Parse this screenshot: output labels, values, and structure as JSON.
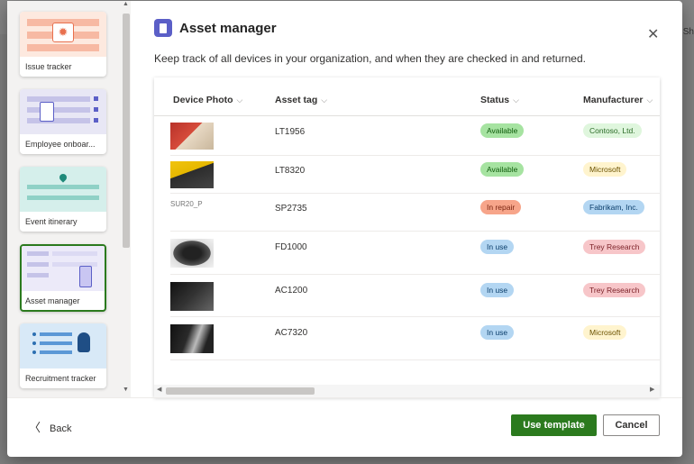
{
  "backdrop": {
    "right_text": "Sh"
  },
  "dialog": {
    "title": "Asset manager",
    "subtitle": "Keep track of all devices in your organization, and when they are checked in and returned."
  },
  "templates": [
    {
      "label": "Issue tracker"
    },
    {
      "label": "Employee onboar..."
    },
    {
      "label": "Event itinerary"
    },
    {
      "label": "Asset manager",
      "selected": true
    },
    {
      "label": "Recruitment tracker"
    }
  ],
  "table": {
    "columns": [
      "Device Photo",
      "Asset tag",
      "Status",
      "Manufacturer"
    ],
    "rows": [
      {
        "asset_tag": "LT1956",
        "status": "Available",
        "manufacturer": "Contoso, Ltd."
      },
      {
        "asset_tag": "LT8320",
        "status": "Available",
        "manufacturer": "Microsoft"
      },
      {
        "photo_alt": "SUR20_P",
        "asset_tag": "SP2735",
        "status": "In repair",
        "manufacturer": "Fabrikam, Inc."
      },
      {
        "asset_tag": "FD1000",
        "status": "In use",
        "manufacturer": "Trey Research"
      },
      {
        "asset_tag": "AC1200",
        "status": "In use",
        "manufacturer": "Trey Research"
      },
      {
        "asset_tag": "AC7320",
        "status": "In use",
        "manufacturer": "Microsoft"
      }
    ]
  },
  "colors": {
    "primary": "#2b7a1e",
    "status_available": "#a6e3a1",
    "status_in_repair": "#f7a58a",
    "status_in_use": "#b3d6f2",
    "mfr_contoso": "#dff6dd",
    "mfr_microsoft": "#fff4ce",
    "mfr_fabrikam": "#b3d6f2",
    "mfr_trey": "#f7c6c9"
  },
  "footer": {
    "back_label": "Back",
    "use_template_label": "Use template",
    "cancel_label": "Cancel"
  }
}
